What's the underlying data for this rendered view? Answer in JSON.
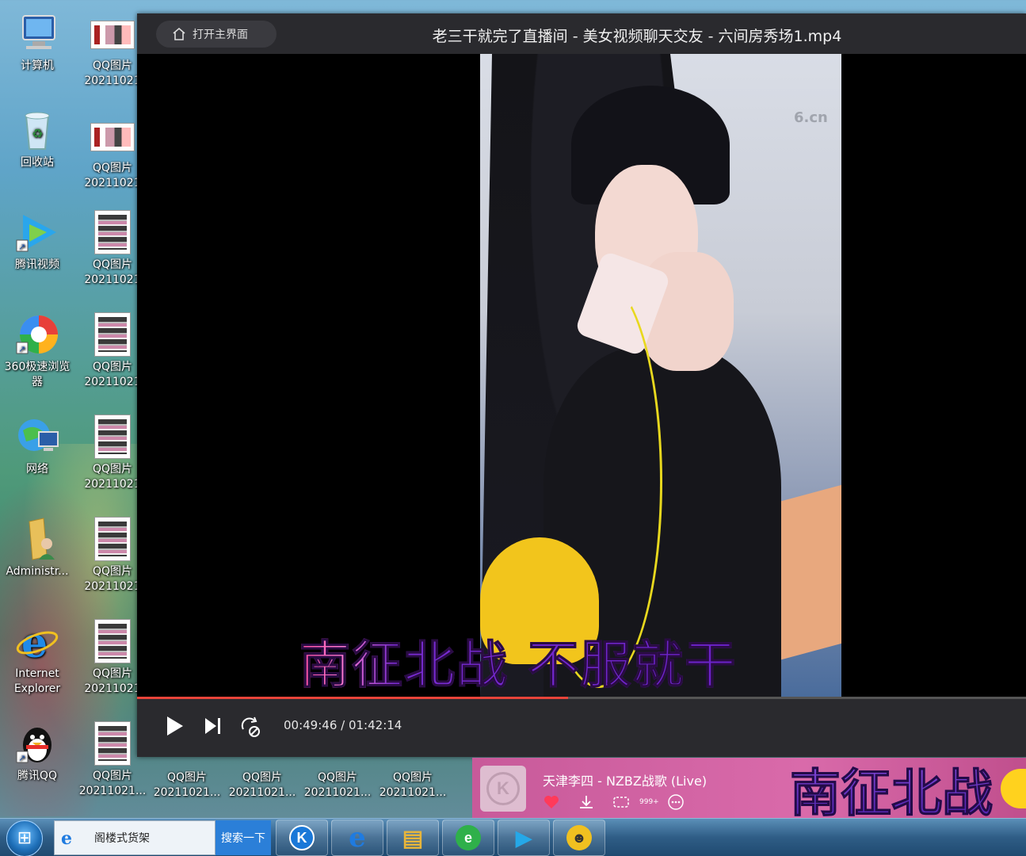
{
  "desktop": {
    "left_icons": [
      {
        "label": "计算机",
        "icon": "computer-icon"
      },
      {
        "label": "回收站",
        "icon": "recycle-bin-icon"
      },
      {
        "label": "腾讯视频",
        "icon": "tencent-video-icon"
      },
      {
        "label": "360极速浏览器",
        "label_l1": "360极速浏览",
        "label_l2": "器",
        "icon": "360-browser-icon"
      },
      {
        "label": "网络",
        "icon": "network-icon"
      },
      {
        "label": "Administr...",
        "icon": "user-folder-icon"
      },
      {
        "label": "Internet Explorer",
        "label_l1": "Internet",
        "label_l2": "Explorer",
        "icon": "ie-icon"
      },
      {
        "label": "腾讯QQ",
        "icon": "qq-penguin-icon"
      }
    ],
    "qq_images": [
      {
        "line1": "QQ图片",
        "line2": "20211021"
      },
      {
        "line1": "QQ图片",
        "line2": "20211021"
      },
      {
        "line1": "QQ图片",
        "line2": "20211021"
      },
      {
        "line1": "QQ图片",
        "line2": "20211021"
      },
      {
        "line1": "QQ图片",
        "line2": "20211021"
      },
      {
        "line1": "QQ图片",
        "line2": "20211021"
      },
      {
        "line1": "QQ图片",
        "line2": "20211021"
      },
      {
        "line1": "QQ图片",
        "line2": "20211021..."
      }
    ],
    "bottom_row": [
      {
        "line1": "QQ图片",
        "line2": "20211021..."
      },
      {
        "line1": "QQ图片",
        "line2": "20211021..."
      },
      {
        "line1": "QQ图片",
        "line2": "20211021..."
      },
      {
        "line1": "QQ图片",
        "line2": "20211021..."
      }
    ]
  },
  "player": {
    "home_button": "打开主界面",
    "title": "老三干就完了直播间 - 美女视频聊天交友 - 六间房秀场1.mp4",
    "video_watermark": "6.cn",
    "lyrics_overlay": "南征北战  不服就干",
    "progress": 0.485,
    "current_time": "00:49:46",
    "total_time": "01:42:14",
    "time_separator": " / ",
    "icons": {
      "home": "home-icon",
      "play": "play-icon",
      "next": "next-track-icon",
      "loop": "loop-icon"
    }
  },
  "music": {
    "song": "天津李四 - NZBZ战歌 (Live)",
    "comment_badge": "999+",
    "big_lyric": "南征北战",
    "icons": [
      "heart-icon",
      "download-icon",
      "comment-icon",
      "more-icon"
    ],
    "album_letter": "K"
  },
  "taskbar": {
    "search_text": "阁楼式货架",
    "search_button": "搜索一下",
    "apps": [
      {
        "name": "kugou-icon",
        "glyph": "K",
        "color": "#1a78d8"
      },
      {
        "name": "ie-taskbar-icon",
        "glyph": "e",
        "color": "#1f7be0"
      },
      {
        "name": "explorer-icon",
        "glyph": "▤",
        "color": "#e8b53a"
      },
      {
        "name": "browser-green-icon",
        "glyph": "e",
        "color": "#2fb04a"
      },
      {
        "name": "tencent-video-taskbar-icon",
        "glyph": "▶",
        "color": "#25a8e8"
      },
      {
        "name": "qq-avatar-icon",
        "glyph": "☻",
        "color": "#f0c020"
      }
    ]
  }
}
